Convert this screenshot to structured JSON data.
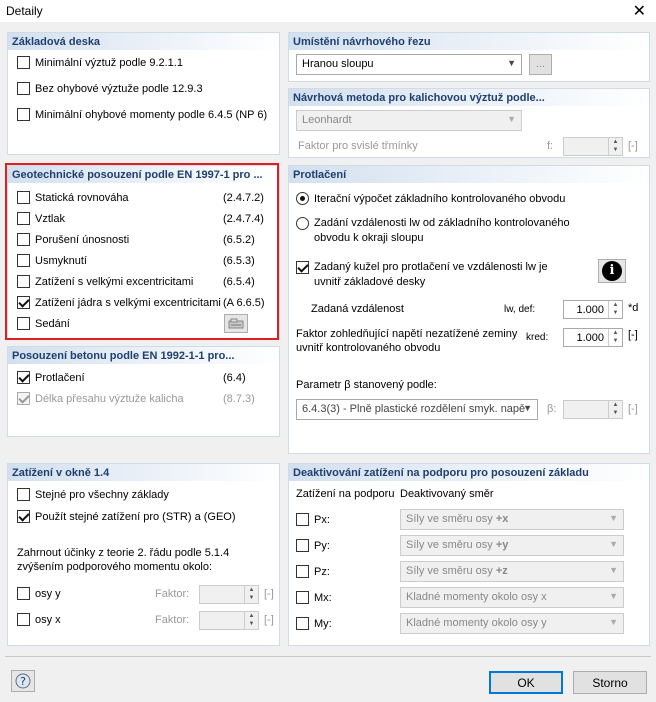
{
  "window": {
    "title": "Detaily"
  },
  "basePlate": {
    "header": "Základová deska",
    "items": [
      {
        "label": "Minimální výztuž podle 9.2.1.1",
        "checked": false
      },
      {
        "label": "Bez ohybové výztuže podle 12.9.3",
        "checked": false
      },
      {
        "label": "Minimální ohybové momenty podle 6.4.5 (NP 6)",
        "checked": false
      }
    ]
  },
  "geotech": {
    "header": "Geotechnické posouzení podle EN 1997-1 pro ...",
    "items": [
      {
        "label": "Statická rovnováha",
        "code": "(2.4.7.2)",
        "checked": false
      },
      {
        "label": "Vztlak",
        "code": "(2.4.7.4)",
        "checked": false
      },
      {
        "label": "Porušení únosnosti",
        "code": "(6.5.2)",
        "checked": false
      },
      {
        "label": "Usmyknutí",
        "code": "(6.5.3)",
        "checked": false
      },
      {
        "label": "Zatížení s velkými excentricitami",
        "code": "(6.5.4)",
        "checked": false
      },
      {
        "label": "Zatížení jádra s velkými excentricitami",
        "code": "(A 6.6.5)",
        "checked": true
      },
      {
        "label": "Sedání",
        "code": "",
        "checked": false
      }
    ]
  },
  "concrete": {
    "header": "Posouzení betonu podle EN 1992-1-1 pro...",
    "items": [
      {
        "label": "Protlačení",
        "code": "(6.4)",
        "checked": true
      },
      {
        "label": "Délka přesahu výztuže kalicha",
        "code": "(8.7.3)",
        "checked": true
      }
    ]
  },
  "loadWindow": {
    "header": "Zatížení v okně 1.4",
    "items": [
      {
        "label": "Stejné pro všechny základy",
        "checked": false
      },
      {
        "label": "Použít stejné zatížení pro (STR) a (GEO)",
        "checked": true
      }
    ],
    "note": "Zahrnout účinky z teorie 2. řádu podle 5.1.4 zvýšením podporového momentu okolo:",
    "axes": [
      {
        "label": "osy y",
        "factor_label": "Faktor:",
        "unit": "[-]"
      },
      {
        "label": "osy x",
        "factor_label": "Faktor:",
        "unit": "[-]"
      }
    ]
  },
  "section": {
    "header": "Umístění návrhového řezu",
    "value": "Hranou sloupu",
    "more": "..."
  },
  "method": {
    "header": "Návrhová metoda pro kalichovou výztuž podle...",
    "value": "Leonhardt",
    "factor_label": "Faktor pro svislé třmínky",
    "f_label": "f:",
    "unit": "[-]"
  },
  "punching": {
    "header": "Protlačení",
    "radio1": "Iterační výpočet základního kontrolovaného obvodu",
    "radio2_line1": "Zadání vzdálenosti lw od základního kontrolovaného",
    "radio2_line2": "obvodu k okraji sloupu",
    "cone_line1": "Zadaný kužel pro protlačení ve vzdálenosti lw je",
    "cone_line2": "uvnitř základové desky",
    "info": "i",
    "dist_label": "Zadaná vzdálenost",
    "dist_sym": "lw, def:",
    "dist_value": "1.000",
    "dist_unit": "*d",
    "factor_line1": "Faktor zohledňující napětí nezatížené zeminy",
    "factor_line2": "uvnitř kontrolovaného obvodu",
    "factor_sym": "kred:",
    "factor_value": "1.000",
    "factor_unit": "[-]",
    "beta_label": "Parametr β stanovený podle:",
    "beta_value": "6.4.3(3) - Plně plastické rozdělení smyk. napě",
    "beta_sym": "β:",
    "beta_unit": "[-]"
  },
  "deactivation": {
    "header": "Deaktivování zatížení na podporu pro posouzení základu",
    "col1": "Zatížení na podporu",
    "col2": "Deaktivovaný směr",
    "rows": [
      {
        "label": "Px:",
        "value": "Síly ve směru osy ",
        "bold": "+x"
      },
      {
        "label": "Py:",
        "value": "Síly ve směru osy ",
        "bold": "+y"
      },
      {
        "label": "Pz:",
        "value": "Síly ve směru osy ",
        "bold": "+z"
      },
      {
        "label": "Mx:",
        "value": "Kladné momenty okolo osy x",
        "bold": ""
      },
      {
        "label": "My:",
        "value": "Kladné momenty okolo osy y",
        "bold": ""
      }
    ]
  },
  "footer": {
    "ok": "OK",
    "cancel": "Storno",
    "help": "?"
  }
}
